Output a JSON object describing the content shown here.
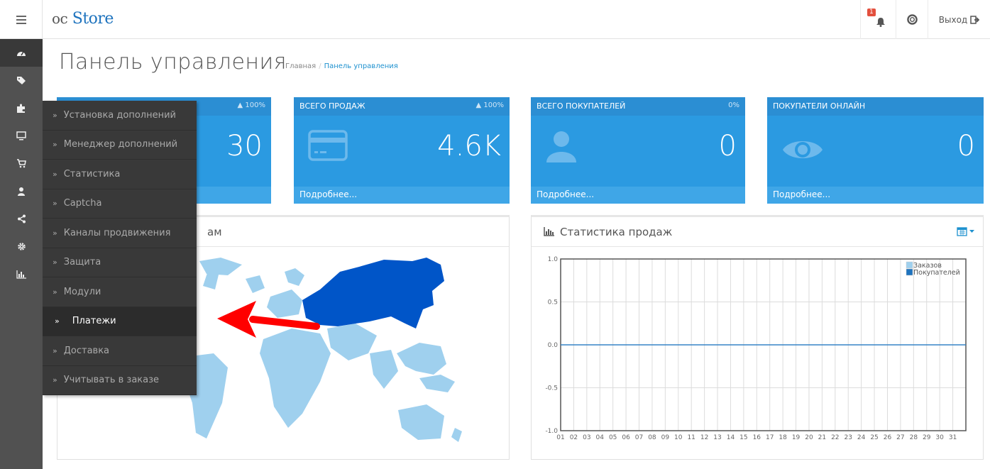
{
  "header": {
    "logo_prefix": "oc",
    "logo_main": "Store",
    "notifications_count": "1",
    "logout_label": "Выход"
  },
  "sidebar": {
    "icons": [
      "dashboard-icon",
      "tags-icon",
      "puzzle-icon",
      "desktop-icon",
      "cart-icon",
      "user-icon",
      "share-icon",
      "cog-icon",
      "bar-chart-icon"
    ]
  },
  "page": {
    "title": "Панель управления",
    "breadcrumb": [
      "Главная",
      "Панель управления"
    ]
  },
  "tiles": [
    {
      "title": "",
      "percent": "100%",
      "value": "30",
      "footer": ""
    },
    {
      "title": "ВСЕГО ПРОДАЖ",
      "percent": "100%",
      "value": "4.6K",
      "footer": "Подробнее..."
    },
    {
      "title": "ВСЕГО ПОКУПАТЕЛЕЙ",
      "percent": "0%",
      "value": "0",
      "footer": "Подробнее..."
    },
    {
      "title": "ПОКУПАТЕЛИ ОНЛАЙН",
      "percent": "",
      "value": "0",
      "footer": "Подробнее..."
    }
  ],
  "map_panel": {
    "title_fragment": "ам"
  },
  "sales_panel": {
    "title": "Статистика продаж"
  },
  "dropdown": {
    "items": [
      "Установка дополнений",
      "Менеджер дополнений",
      "Статистика",
      "Captcha",
      "Каналы продвижения",
      "Защита",
      "Модули",
      "Платежи",
      "Доставка",
      "Учитывать в заказе"
    ],
    "selected_index": 7
  },
  "colors": {
    "accent": "#2b9ae1",
    "sidebar": "#515151",
    "dropdown": "#393939",
    "map_highlight": "#0055c8",
    "map_base": "#9fd0ee",
    "arrow": "#ff0000"
  },
  "chart_data": {
    "type": "line",
    "title": "Статистика продаж",
    "x": [
      "01",
      "02",
      "03",
      "04",
      "05",
      "06",
      "07",
      "08",
      "09",
      "10",
      "11",
      "12",
      "13",
      "14",
      "15",
      "16",
      "17",
      "18",
      "19",
      "20",
      "21",
      "22",
      "23",
      "24",
      "25",
      "26",
      "27",
      "28",
      "29",
      "30",
      "31"
    ],
    "ylim": [
      -1.0,
      1.0
    ],
    "yticks": [
      "1.0",
      "0.5",
      "0.0",
      "-0.5",
      "-1.0"
    ],
    "series": [
      {
        "name": "Заказов",
        "color": "#9fd0ee",
        "values": [
          0,
          0,
          0,
          0,
          0,
          0,
          0,
          0,
          0,
          0,
          0,
          0,
          0,
          0,
          0,
          0,
          0,
          0,
          0,
          0,
          0,
          0,
          0,
          0,
          0,
          0,
          0,
          0,
          0,
          0,
          0
        ]
      },
      {
        "name": "Покупателей",
        "color": "#1e73be",
        "values": [
          0,
          0,
          0,
          0,
          0,
          0,
          0,
          0,
          0,
          0,
          0,
          0,
          0,
          0,
          0,
          0,
          0,
          0,
          0,
          0,
          0,
          0,
          0,
          0,
          0,
          0,
          0,
          0,
          0,
          0,
          0
        ]
      }
    ],
    "legend": "top-right",
    "grid": true
  }
}
